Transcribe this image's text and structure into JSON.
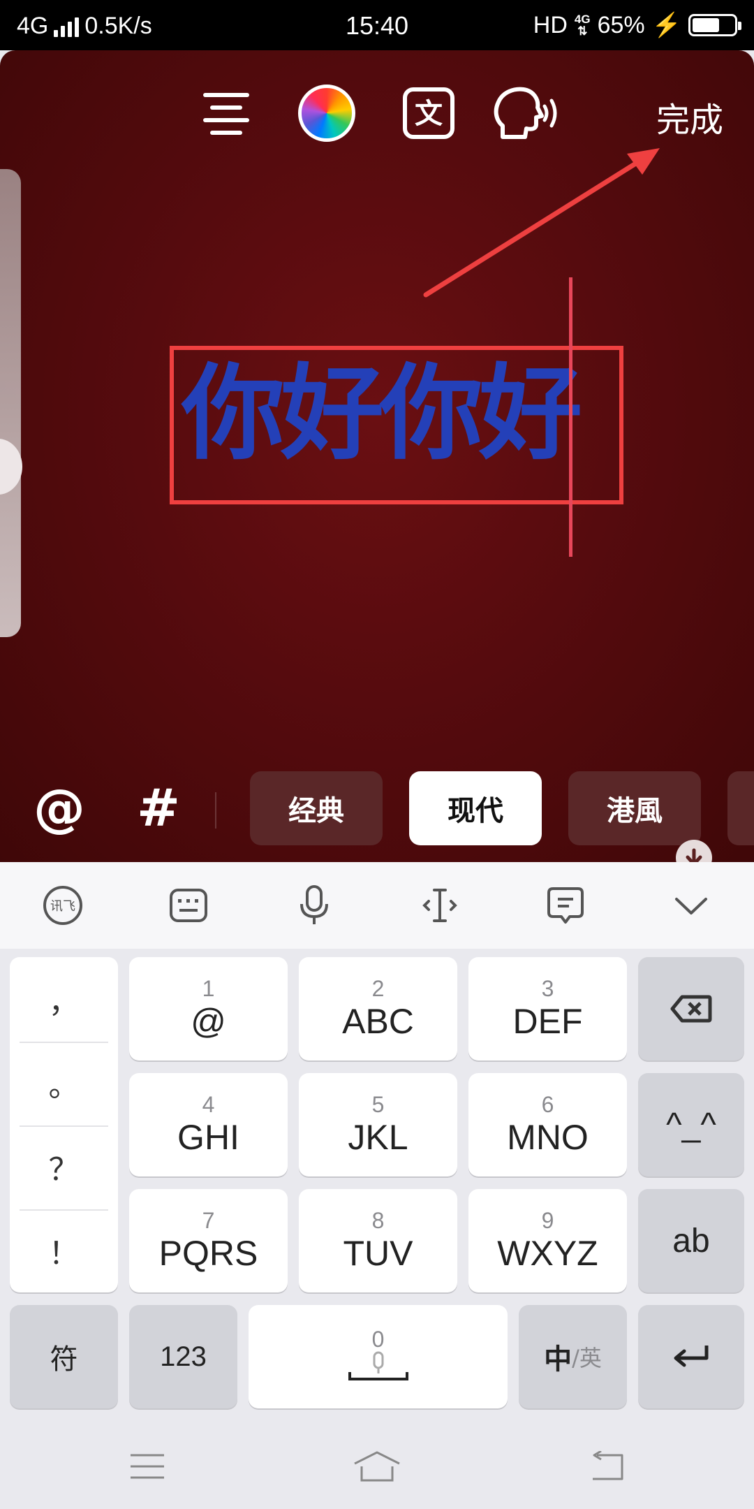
{
  "status_bar": {
    "network": "4G",
    "speed": "0.5K/s",
    "time": "15:40",
    "hd": "HD",
    "net_badge": "4G",
    "battery": "65%",
    "battery_level": 0.65
  },
  "editor": {
    "toolbar": {
      "icons": [
        "align-icon",
        "color-wheel-icon",
        "text-style-icon",
        "voice-read-icon"
      ],
      "text_style_glyph": "文",
      "done_label": "完成"
    },
    "text_content": "你好你好",
    "text_color": "#2440b8",
    "annotation_color": "#ef4040",
    "mention_symbol": "@",
    "hashtag_symbol": "#",
    "styles": [
      {
        "label": "经典",
        "active": false
      },
      {
        "label": "现代",
        "active": true
      },
      {
        "label": "港風",
        "active": false
      }
    ]
  },
  "keyboard": {
    "toolbar_icons": [
      "xunfei-logo-icon",
      "keyboard-icon",
      "microphone-icon",
      "cursor-move-icon",
      "clipboard-icon",
      "collapse-chevron-icon"
    ],
    "xunfei_glyph": "讯飞",
    "punctuation": [
      "，",
      "。",
      "？",
      "！"
    ],
    "keys": [
      {
        "num": "1",
        "letters": "@"
      },
      {
        "num": "2",
        "letters": "ABC"
      },
      {
        "num": "3",
        "letters": "DEF"
      },
      {
        "num": "4",
        "letters": "GHI"
      },
      {
        "num": "5",
        "letters": "JKL"
      },
      {
        "num": "6",
        "letters": "MNO"
      },
      {
        "num": "7",
        "letters": "PQRS"
      },
      {
        "num": "8",
        "letters": "TUV"
      },
      {
        "num": "9",
        "letters": "WXYZ"
      }
    ],
    "emoticon": "^_^",
    "ab": "ab",
    "symbol_key": "符",
    "numeric_key": "123",
    "space_num": "0",
    "lang_primary": "中",
    "lang_secondary": "/英"
  },
  "nav": {
    "icons": [
      "menu-icon",
      "home-icon",
      "back-icon"
    ]
  }
}
